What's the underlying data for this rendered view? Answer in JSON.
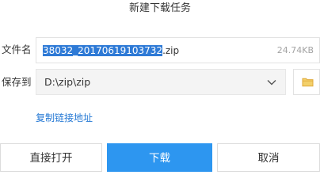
{
  "dialog": {
    "title": "新建下载任务"
  },
  "filename": {
    "label": "文件名",
    "selected_part": "38032_20170619103732",
    "extension": ".zip",
    "size": "24.74KB"
  },
  "save_to": {
    "label": "保存到",
    "path": "D:\\zip\\zip",
    "dropdown_icon": "chevron-down-icon",
    "browse_icon": "folder-icon"
  },
  "links": {
    "copy_link": "复制链接地址"
  },
  "buttons": {
    "open_directly": "直接打开",
    "download": "下载",
    "cancel": "取消"
  },
  "colors": {
    "accent": "#2d96f0",
    "selection": "#2e7ad6",
    "link": "#2478d4",
    "folder": "#f0c659"
  }
}
